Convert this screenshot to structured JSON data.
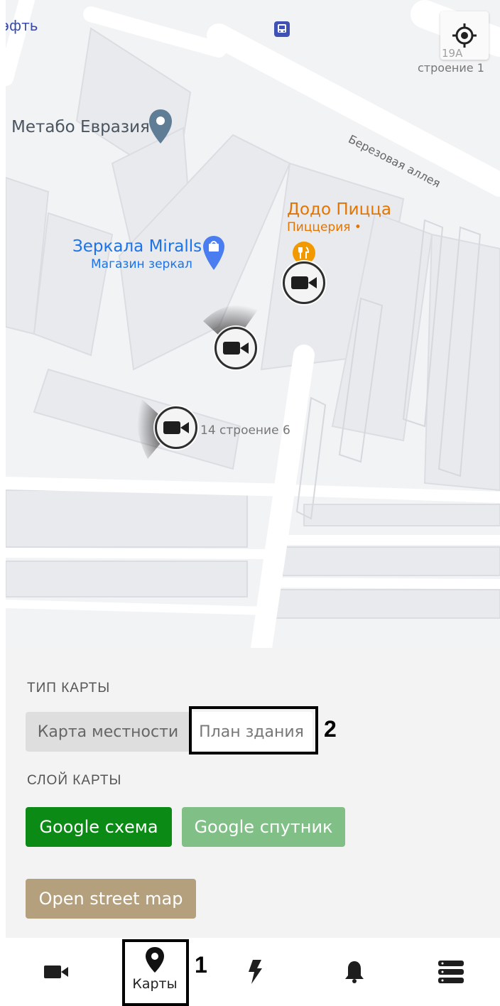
{
  "map": {
    "top_left_label": "эфть",
    "address_19a_number": "19A",
    "address_19a_building": "строение 1",
    "street_name": "Березовая аллея",
    "place_metabo": "Метабо Евразия",
    "place_dodo_name": "Додо Пицца",
    "place_dodo_type": "Пиццерия •",
    "place_mirralls_name": "Зеркала Miralls",
    "place_mirralls_type": "Магазин зеркал",
    "address_building6": "14 строение 6",
    "colors": {
      "dodo": "#e37400",
      "mirralls": "#1a73e8",
      "metabo_pin": "#5f7d95"
    }
  },
  "panel": {
    "map_type_label": "ТИП КАРТЫ",
    "map_type_terrain": "Карта местности",
    "map_type_building": "План здания",
    "map_layer_label": "СЛОЙ КАРТЫ",
    "layer_google_scheme": "Google схема",
    "layer_google_satellite": "Google спутник",
    "layer_osm": "Open street map",
    "colors": {
      "google_scheme": "#0b8a15",
      "google_satellite": "#80bf86",
      "osm": "#b5a07e"
    }
  },
  "nav": {
    "maps_label": "Карты",
    "icons": [
      "camera-icon",
      "map-pin-icon",
      "bolt-icon",
      "bell-icon",
      "list-icon"
    ]
  },
  "annotations": {
    "one": "1",
    "two": "2"
  }
}
